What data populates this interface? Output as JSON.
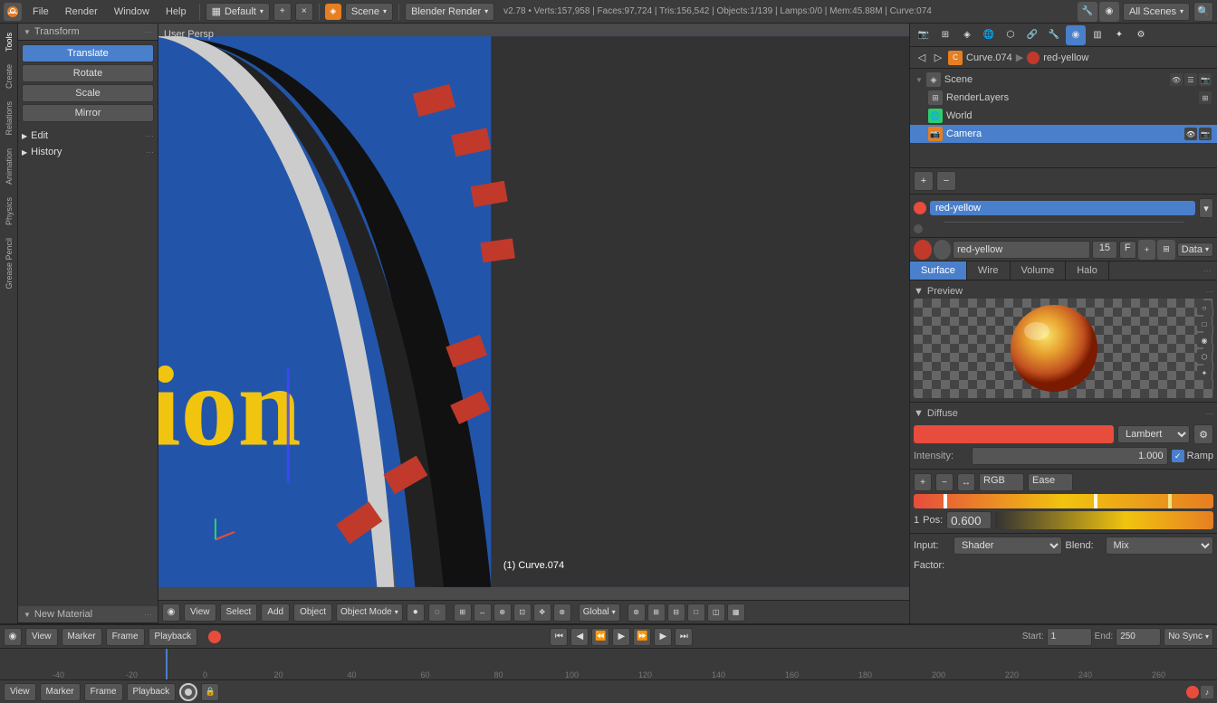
{
  "topbar": {
    "logo": "B",
    "menus": [
      "File",
      "Render",
      "Window",
      "Help"
    ],
    "layout_icon": "▦",
    "layout_label": "Default",
    "add_icon": "+",
    "close_icon": "×",
    "scene_icon": "◈",
    "scene_label": "Scene",
    "render_engine": "Blender Render",
    "version_info": "v2.78 • Verts:157,958 | Faces:97,724 | Tris:156,542 | Objects:1/139 | Lamps:0/0 | Mem:45.88M | Curve:074",
    "search_placeholder": "All Scenes"
  },
  "tools": {
    "header": "Transform",
    "translate": "Translate",
    "rotate": "Rotate",
    "scale": "Scale",
    "mirror": "Mirror",
    "edit_label": "Edit",
    "history_label": "History",
    "new_material": "New Material"
  },
  "viewport": {
    "label": "User Persp",
    "object_info": "(1) Curve.074"
  },
  "viewport_bottom": {
    "view": "View",
    "select": "Select",
    "add": "Add",
    "object": "Object",
    "mode": "Object Mode",
    "global": "Global"
  },
  "right_panel": {
    "scene_label": "Scene",
    "render_layers": "RenderLayers",
    "world": "World",
    "camera": "Camera",
    "breadcrumb_curve": "Curve.074",
    "breadcrumb_mat": "red-yellow",
    "material_name": "red-yellow",
    "material_name2": "red-yellow",
    "mat_number": "15",
    "mat_f": "F",
    "mat_data": "Data",
    "tabs": [
      "Surface",
      "Wire",
      "Volume",
      "Halo"
    ],
    "active_tab": "Surface",
    "preview_header": "Preview",
    "diffuse_header": "Diffuse",
    "diffuse_shader": "Lambert",
    "intensity_label": "Intensity:",
    "intensity_value": "1.000",
    "ramp_label": "Ramp",
    "color_strip_labels": [
      "RGB",
      "Ease"
    ],
    "pos_label": "Pos:",
    "pos_value": "0.600",
    "pos_number": "1",
    "input_label": "Input:",
    "input_value": "Shader",
    "blend_label": "Blend:",
    "blend_value": "Mix",
    "factor_label": "Factor:"
  },
  "timeline": {
    "view": "View",
    "marker": "Marker",
    "frame": "Frame",
    "playback": "Playback",
    "start_label": "Start:",
    "start_value": "1",
    "end_label": "End:",
    "end_value": "250",
    "no_sync": "No Sync",
    "ruler_marks": [
      "-40",
      "-20",
      "0",
      "20",
      "40",
      "60",
      "80",
      "100",
      "120",
      "140",
      "160",
      "180",
      "200",
      "220",
      "240",
      "260"
    ]
  },
  "sidebar_tabs": [
    "Tools",
    "Create",
    "Relations",
    "Animation",
    "Physics",
    "Grease Pencil"
  ]
}
